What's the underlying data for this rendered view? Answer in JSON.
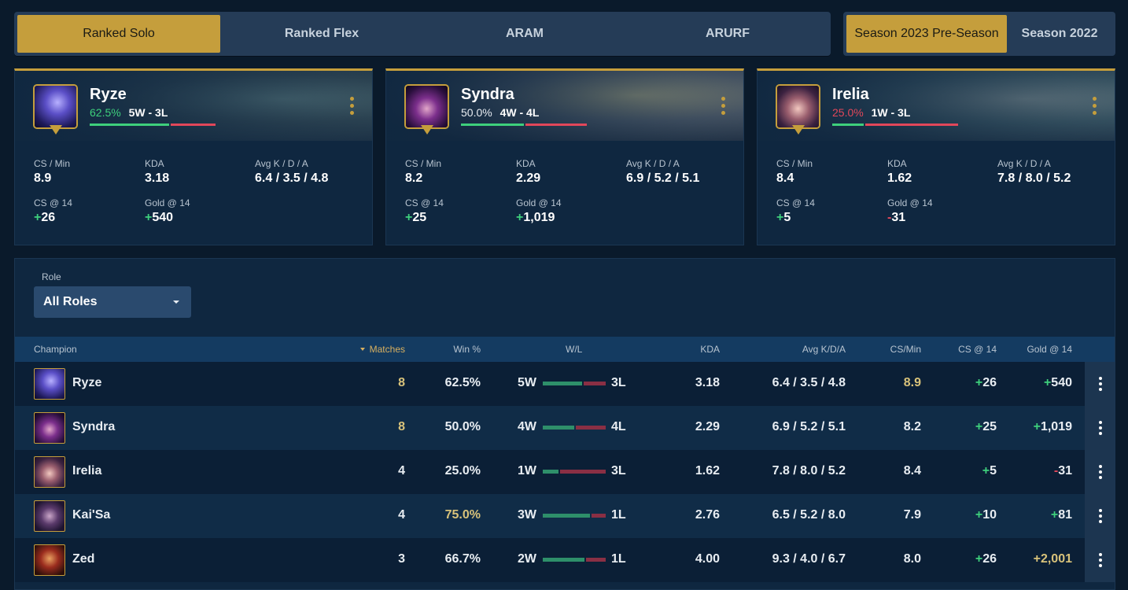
{
  "queue_tabs": [
    {
      "label": "Ranked Solo",
      "active": true
    },
    {
      "label": "Ranked Flex",
      "active": false
    },
    {
      "label": "ARAM",
      "active": false
    },
    {
      "label": "ARURF",
      "active": false
    }
  ],
  "season_tabs": [
    {
      "label": "Season 2023 Pre-Season",
      "active": true
    },
    {
      "label": "Season 2022",
      "active": false
    }
  ],
  "colors": {
    "accent_gold": "#c59e3c",
    "win_green": "#3ed07c",
    "loss_red": "#e2475a",
    "highlight_gold": "#d8c27a"
  },
  "cards": [
    {
      "name": "Ryze",
      "win_pct": "62.5%",
      "win_pct_tone": "green",
      "record": "5W - 3L",
      "win_fraction": 0.625,
      "avatar_icon": "ryze-portrait-icon",
      "stats": {
        "cs_min_label": "CS / Min",
        "cs_min": "8.9",
        "kda_label": "KDA",
        "kda": "3.18",
        "avg_label": "Avg K / D / A",
        "avg": "6.4 / 3.5 / 4.8",
        "cs14_label": "CS @ 14",
        "cs14_sign": "+",
        "cs14": "26",
        "gold14_label": "Gold @ 14",
        "gold14_sign": "+",
        "gold14": "540"
      }
    },
    {
      "name": "Syndra",
      "win_pct": "50.0%",
      "win_pct_tone": "white",
      "record": "4W - 4L",
      "win_fraction": 0.5,
      "avatar_icon": "syndra-portrait-icon",
      "stats": {
        "cs_min_label": "CS / Min",
        "cs_min": "8.2",
        "kda_label": "KDA",
        "kda": "2.29",
        "avg_label": "Avg K / D / A",
        "avg": "6.9 / 5.2 / 5.1",
        "cs14_label": "CS @ 14",
        "cs14_sign": "+",
        "cs14": "25",
        "gold14_label": "Gold @ 14",
        "gold14_sign": "+",
        "gold14": "1,019"
      }
    },
    {
      "name": "Irelia",
      "win_pct": "25.0%",
      "win_pct_tone": "red",
      "record": "1W - 3L",
      "win_fraction": 0.25,
      "avatar_icon": "irelia-portrait-icon",
      "stats": {
        "cs_min_label": "CS / Min",
        "cs_min": "8.4",
        "kda_label": "KDA",
        "kda": "1.62",
        "avg_label": "Avg K / D / A",
        "avg": "7.8 / 8.0 / 5.2",
        "cs14_label": "CS @ 14",
        "cs14_sign": "+",
        "cs14": "5",
        "gold14_label": "Gold @ 14",
        "gold14_sign": "-",
        "gold14": "31"
      }
    }
  ],
  "filter": {
    "role_label": "Role",
    "role_value": "All Roles"
  },
  "table": {
    "headers": {
      "champion": "Champion",
      "matches": "Matches",
      "win_pct": "Win %",
      "wl": "W/L",
      "kda": "KDA",
      "avg": "Avg K/D/A",
      "cs_min": "CS/Min",
      "cs14": "CS @ 14",
      "gold14": "Gold @ 14"
    },
    "rows": [
      {
        "champion": "Ryze",
        "matches": "8",
        "win_pct": "62.5%",
        "wins": "5W",
        "losses": "3L",
        "win_fraction": 0.625,
        "kda": "3.18",
        "avg": "6.4 / 3.5 / 4.8",
        "cs_min": "8.9",
        "cs14_sign": "+",
        "cs14": "26",
        "gold14_sign": "+",
        "gold14": "540",
        "highlight": {
          "matches": true,
          "win_pct": false,
          "cs_min": true,
          "gold14": false
        }
      },
      {
        "champion": "Syndra",
        "matches": "8",
        "win_pct": "50.0%",
        "wins": "4W",
        "losses": "4L",
        "win_fraction": 0.5,
        "kda": "2.29",
        "avg": "6.9 / 5.2 / 5.1",
        "cs_min": "8.2",
        "cs14_sign": "+",
        "cs14": "25",
        "gold14_sign": "+",
        "gold14": "1,019",
        "highlight": {
          "matches": true,
          "win_pct": false,
          "cs_min": false,
          "gold14": false
        }
      },
      {
        "champion": "Irelia",
        "matches": "4",
        "win_pct": "25.0%",
        "wins": "1W",
        "losses": "3L",
        "win_fraction": 0.25,
        "kda": "1.62",
        "avg": "7.8 / 8.0 / 5.2",
        "cs_min": "8.4",
        "cs14_sign": "+",
        "cs14": "5",
        "gold14_sign": "-",
        "gold14": "31",
        "highlight": {
          "matches": false,
          "win_pct": false,
          "cs_min": false,
          "gold14": false
        }
      },
      {
        "champion": "Kai'Sa",
        "matches": "4",
        "win_pct": "75.0%",
        "wins": "3W",
        "losses": "1L",
        "win_fraction": 0.75,
        "kda": "2.76",
        "avg": "6.5 / 5.2 / 8.0",
        "cs_min": "7.9",
        "cs14_sign": "+",
        "cs14": "10",
        "gold14_sign": "+",
        "gold14": "81",
        "highlight": {
          "matches": false,
          "win_pct": true,
          "cs_min": false,
          "gold14": false
        }
      },
      {
        "champion": "Zed",
        "matches": "3",
        "win_pct": "66.7%",
        "wins": "2W",
        "losses": "1L",
        "win_fraction": 0.667,
        "kda": "4.00",
        "avg": "9.3 / 4.0 / 6.7",
        "cs_min": "8.0",
        "cs14_sign": "+",
        "cs14": "26",
        "gold14_sign": "",
        "gold14": "+2,001",
        "highlight": {
          "matches": false,
          "win_pct": false,
          "cs_min": false,
          "gold14": true
        }
      }
    ]
  }
}
